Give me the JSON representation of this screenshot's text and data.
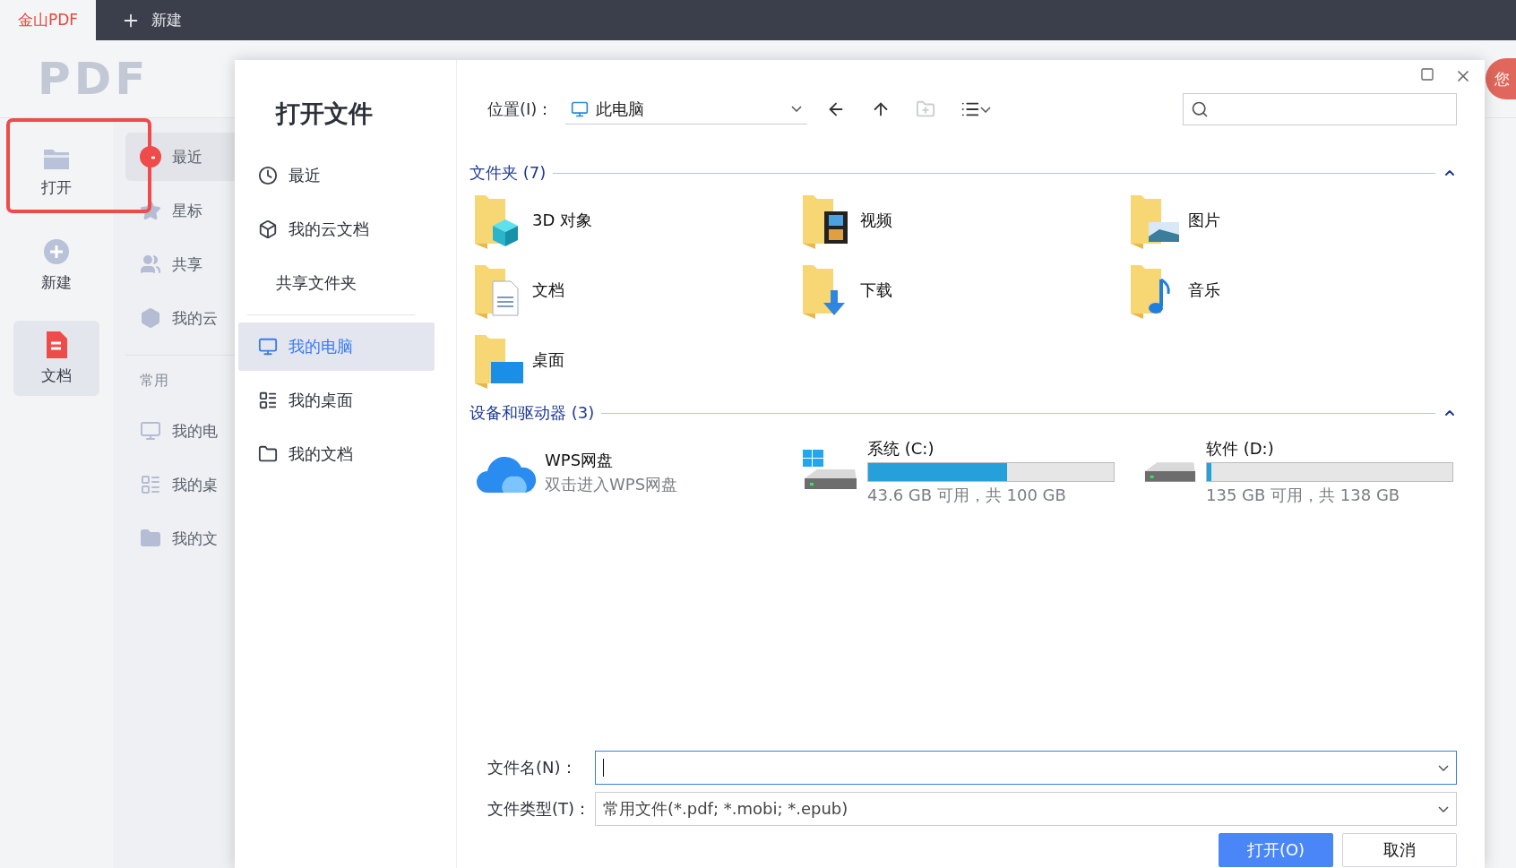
{
  "tabs": [
    {
      "label": "金山PDF",
      "selected": true,
      "kind": "app"
    },
    {
      "label": "新建",
      "selected": false,
      "kind": "new"
    }
  ],
  "app": {
    "logo": "PDF",
    "rail": [
      {
        "label": "打开",
        "kind": "folder",
        "selected": false,
        "annotated": true
      },
      {
        "label": "新建",
        "kind": "plus",
        "selected": false,
        "annotated": false
      },
      {
        "label": "文档",
        "kind": "doc",
        "selected": true,
        "annotated": false
      }
    ],
    "nav": [
      {
        "label": "最近",
        "kind": "clock",
        "selected": true
      },
      {
        "label": "星标",
        "kind": "star",
        "selected": false
      },
      {
        "label": "共享",
        "kind": "people",
        "selected": false
      },
      {
        "label": "我的云",
        "kind": "cube",
        "selected": false
      }
    ],
    "section": "常用",
    "shortcuts": [
      {
        "label": "我的电",
        "kind": "computer"
      },
      {
        "label": "我的桌",
        "kind": "desktop"
      },
      {
        "label": "我的文",
        "kind": "folder"
      }
    ]
  },
  "avatar": {
    "text": "您"
  },
  "dialog": {
    "title": "打开文件",
    "sidebar": [
      {
        "label": "最近",
        "kind": "clock",
        "selected": false
      },
      {
        "label": "我的云文档",
        "kind": "cube",
        "selected": false
      },
      {
        "label": "共享文件夹",
        "kind": "plain",
        "selected": false
      },
      {
        "label": "我的电脑",
        "kind": "monitor",
        "selected": true
      },
      {
        "label": "我的桌面",
        "kind": "desktop",
        "selected": false
      },
      {
        "label": "我的文档",
        "kind": "folder",
        "selected": false
      }
    ],
    "location_label": "位置(I)：",
    "location_value": "此电脑",
    "folders": {
      "title": "文件夹 (7)",
      "expanded": true,
      "items": [
        {
          "name": "3D 对象",
          "kind": "objects"
        },
        {
          "name": "视频",
          "kind": "video"
        },
        {
          "name": "图片",
          "kind": "pictures"
        },
        {
          "name": "文档",
          "kind": "documents"
        },
        {
          "name": "下载",
          "kind": "downloads"
        },
        {
          "name": "音乐",
          "kind": "music"
        },
        {
          "name": "桌面",
          "kind": "desktop"
        }
      ]
    },
    "drives": {
      "title": "设备和驱动器 (3)",
      "expanded": true,
      "items": [
        {
          "kind": "cloud",
          "name": "WPS网盘",
          "detail": "双击进入WPS网盘"
        },
        {
          "kind": "system",
          "name": "系统 (C:)",
          "detail": "43.6 GB 可用，共 100 GB",
          "level": 0.564
        },
        {
          "kind": "disk",
          "name": "软件 (D:)",
          "detail": "135 GB 可用，共 138 GB",
          "level": 0.02
        }
      ]
    },
    "filename_label": "文件名(N)：",
    "filetype_label": "文件类型(T)：",
    "filetype_value": "常用文件(*.pdf; *.mobi; *.epub)",
    "buttons": [
      {
        "label": "打开(O)",
        "kind": "primary"
      },
      {
        "label": "取消",
        "kind": "secondary"
      }
    ]
  }
}
